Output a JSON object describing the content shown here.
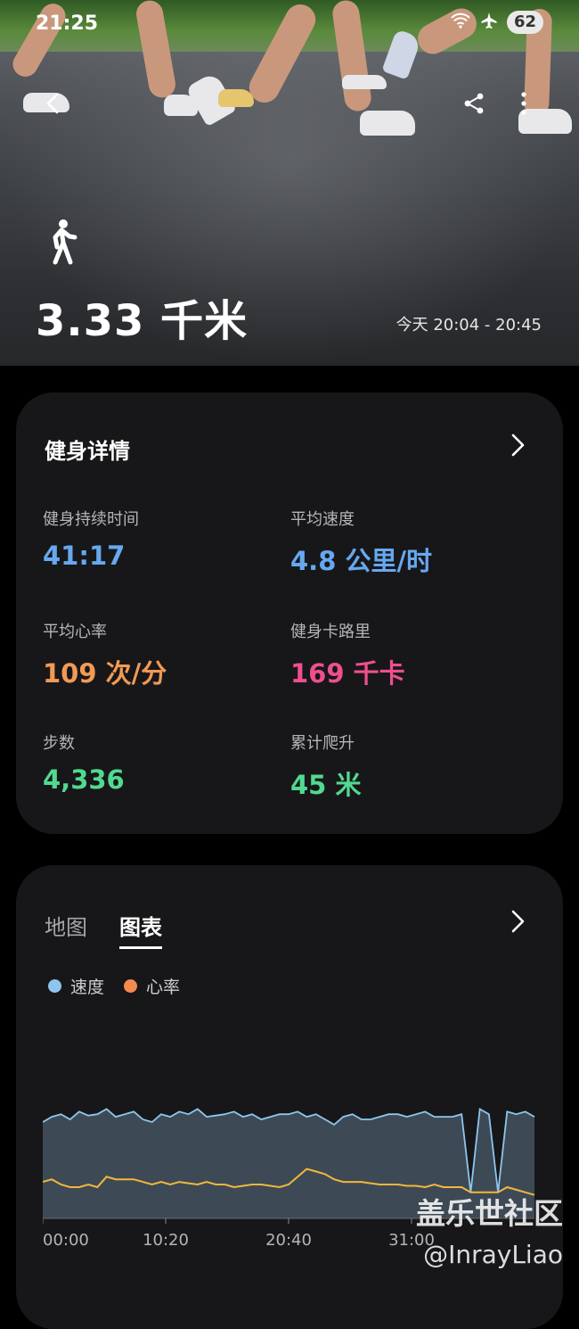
{
  "status": {
    "time": "21:25",
    "battery": "62"
  },
  "hero": {
    "distance": "3.33 千米",
    "time_range": "今天 20:04 - 20:45",
    "icons": [
      "back-icon",
      "share-icon",
      "more-icon",
      "walking-icon"
    ]
  },
  "details": {
    "title": "健身详情",
    "metrics": [
      {
        "label": "健身持续时间",
        "value": "41:17",
        "color": "#67a8ef"
      },
      {
        "label": "平均速度",
        "value": "4.8 公里/时",
        "color": "#67a8ef"
      },
      {
        "label": "平均心率",
        "value": "109 次/分",
        "color": "#f29a53"
      },
      {
        "label": "健身卡路里",
        "value": "169 千卡",
        "color": "#ef4f8e"
      },
      {
        "label": "步数",
        "value": "4,336",
        "color": "#51d98f"
      },
      {
        "label": "累计爬升",
        "value": "45 米",
        "color": "#51d98f"
      }
    ]
  },
  "charts": {
    "tabs": [
      {
        "label": "地图",
        "active": false
      },
      {
        "label": "图表",
        "active": true
      }
    ],
    "legend": [
      {
        "label": "速度",
        "color": "#8ec6ee"
      },
      {
        "label": "心率",
        "color": "#f58a4f"
      }
    ],
    "x_ticks": [
      "00:00",
      "10:20",
      "20:40",
      "31:00"
    ]
  },
  "chart_data": {
    "type": "area",
    "x_label": "",
    "x_ticks": [
      "00:00",
      "10:20",
      "20:40",
      "31:00"
    ],
    "series": [
      {
        "name": "速度",
        "color": "#8ec6ee",
        "values": [
          0.74,
          0.78,
          0.8,
          0.76,
          0.82,
          0.79,
          0.8,
          0.84,
          0.78,
          0.8,
          0.82,
          0.76,
          0.74,
          0.8,
          0.78,
          0.82,
          0.8,
          0.84,
          0.78,
          0.79,
          0.8,
          0.82,
          0.78,
          0.8,
          0.76,
          0.78,
          0.8,
          0.8,
          0.82,
          0.78,
          0.8,
          0.76,
          0.72,
          0.78,
          0.8,
          0.76,
          0.76,
          0.78,
          0.8,
          0.8,
          0.78,
          0.8,
          0.82,
          0.78,
          0.78,
          0.78,
          0.8,
          0.2,
          0.84,
          0.8,
          0.2,
          0.82,
          0.8,
          0.82,
          0.78
        ]
      },
      {
        "name": "心率",
        "color": "#f2b73c",
        "values": [
          0.28,
          0.3,
          0.26,
          0.24,
          0.24,
          0.26,
          0.24,
          0.32,
          0.3,
          0.3,
          0.3,
          0.28,
          0.26,
          0.28,
          0.26,
          0.28,
          0.27,
          0.26,
          0.28,
          0.26,
          0.26,
          0.24,
          0.25,
          0.26,
          0.26,
          0.25,
          0.24,
          0.26,
          0.32,
          0.38,
          0.36,
          0.34,
          0.3,
          0.28,
          0.28,
          0.28,
          0.27,
          0.26,
          0.26,
          0.26,
          0.25,
          0.25,
          0.24,
          0.26,
          0.24,
          0.24,
          0.24,
          0.2,
          0.2,
          0.2,
          0.2,
          0.24,
          0.22,
          0.2,
          0.18
        ]
      }
    ]
  },
  "watermark": {
    "line1": "盖乐世社区",
    "line2": "@InrayLiao"
  }
}
